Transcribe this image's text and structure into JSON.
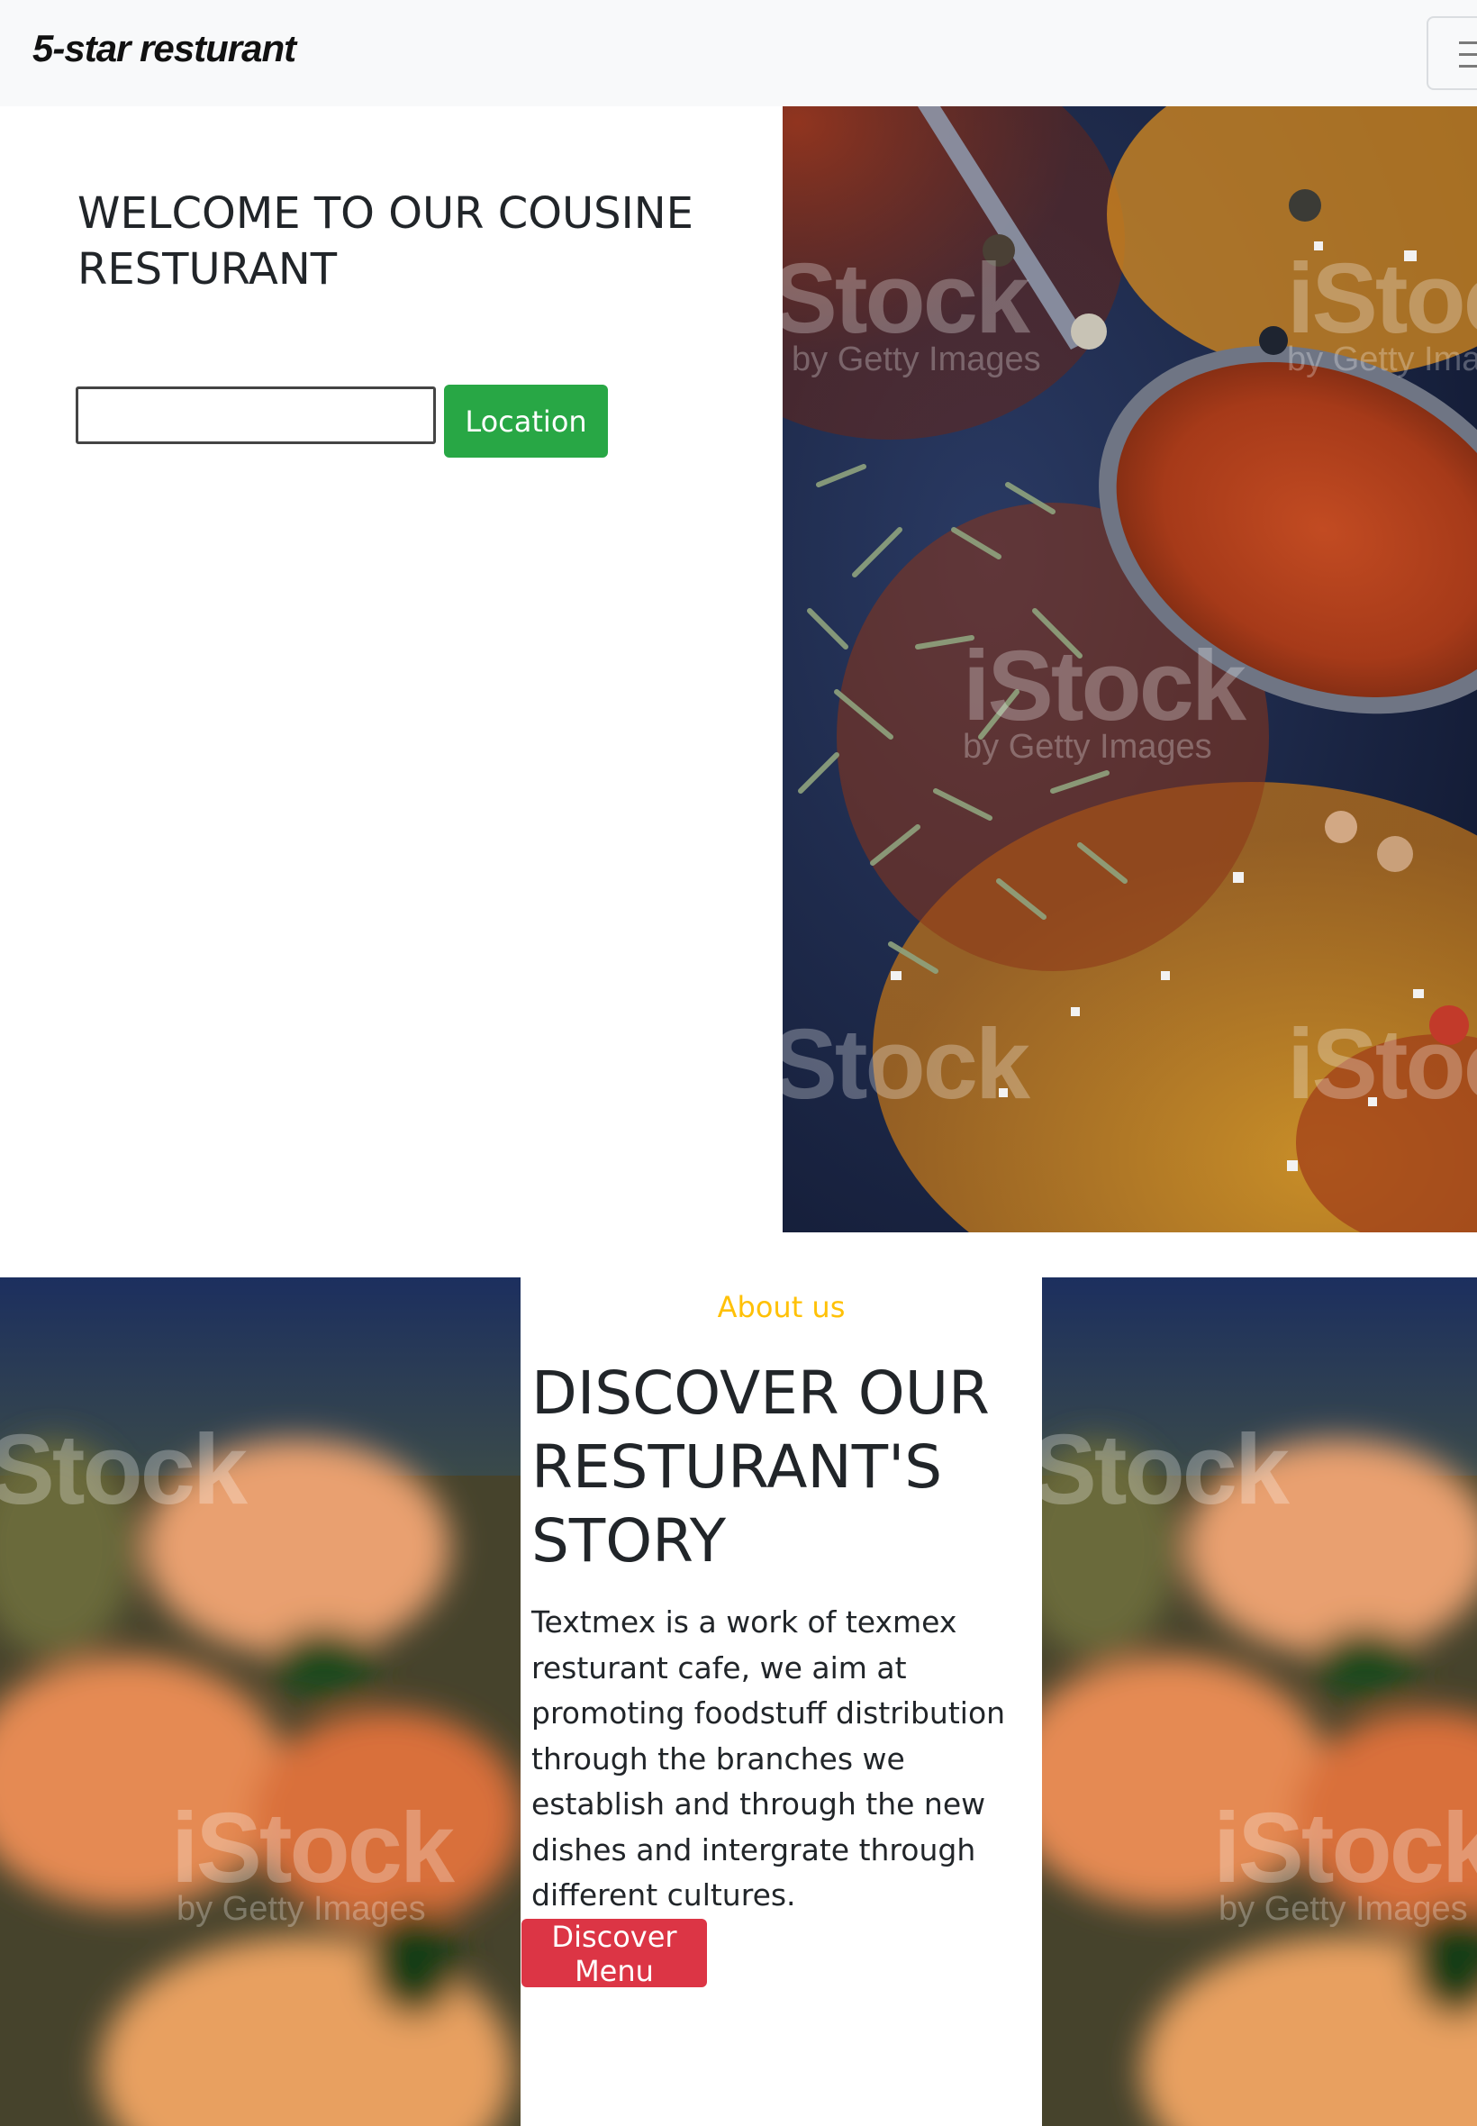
{
  "navbar": {
    "brand": "5-star resturant",
    "toggler_icon": "hamburger-icon"
  },
  "hero": {
    "title": "WELCOME TO OUR COUSINE RESTURANT",
    "search_value": "",
    "location_button": "Location",
    "image_watermark_main": "iStock",
    "image_watermark_sub": "by Getty Images"
  },
  "about": {
    "kicker": "About us",
    "title": "DISCOVER OUR RESTURANT'S STORY",
    "text": "Textmex is a work of texmex resturant cafe, we aim at promoting foodstuff distribution through the branches we establish and through the new dishes and intergrate through different cultures.",
    "button": "Discover Menu"
  },
  "colors": {
    "navbar_bg": "#f8f9fa",
    "success": "#28a745",
    "danger": "#dc3545",
    "warning": "#ffc107"
  }
}
